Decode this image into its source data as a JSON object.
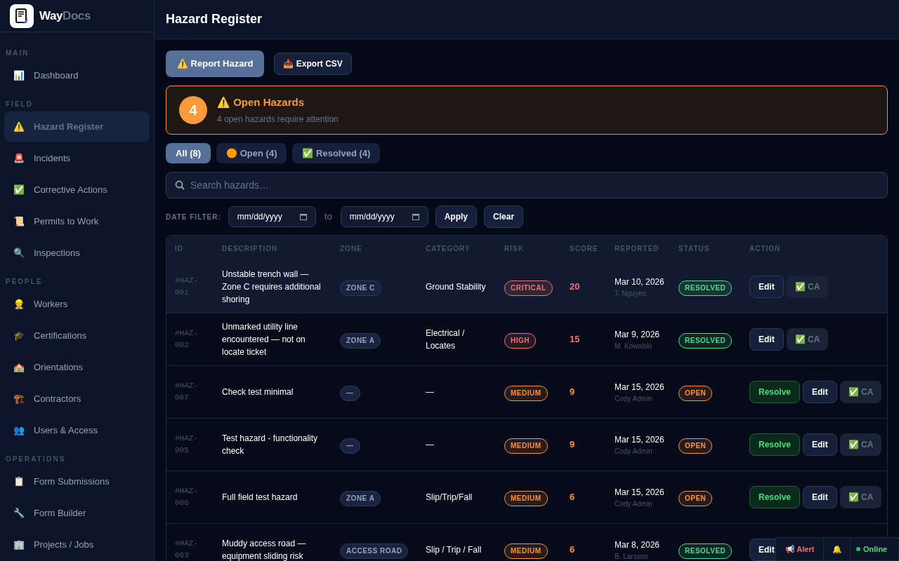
{
  "sidebar": {
    "logo": {
      "word_1": "Way",
      "word_2": "Docs"
    },
    "sections": [
      {
        "title": "MAIN",
        "items": [
          {
            "icon": "📊",
            "label": "Dashboard",
            "selected": false
          }
        ]
      },
      {
        "title": "FIELD",
        "items": [
          {
            "icon": "⚠️",
            "label": "Hazard Register",
            "selected": true
          },
          {
            "icon": "🚨",
            "label": "Incidents",
            "selected": false
          },
          {
            "icon": "✅",
            "label": "Corrective Actions",
            "selected": false
          },
          {
            "icon": "📜",
            "label": "Permits to Work",
            "selected": false
          },
          {
            "icon": "🔍",
            "label": "Inspections",
            "selected": false
          }
        ]
      },
      {
        "title": "PEOPLE",
        "items": [
          {
            "icon": "👷",
            "label": "Workers",
            "selected": false
          },
          {
            "icon": "🎓",
            "label": "Certifications",
            "selected": false
          },
          {
            "icon": "🏫",
            "label": "Orientations",
            "selected": false
          },
          {
            "icon": "🏗️",
            "label": "Contractors",
            "selected": false
          },
          {
            "icon": "👥",
            "label": "Users & Access",
            "selected": false
          }
        ]
      },
      {
        "title": "OPERATIONS",
        "items": [
          {
            "icon": "📋",
            "label": "Form Submissions",
            "selected": false
          },
          {
            "icon": "🔧",
            "label": "Form Builder",
            "selected": false
          },
          {
            "icon": "🏢",
            "label": "Projects / Jobs",
            "selected": false
          }
        ]
      }
    ]
  },
  "header": {
    "title": "Hazard Register"
  },
  "toolbar": {
    "buttons": [
      {
        "label": "⚠️ Report Hazard",
        "kind": "primary"
      },
      {
        "label": "📥 Export CSV",
        "kind": "secondary"
      }
    ]
  },
  "alert": {
    "count": "4",
    "title": "⚠️ Open Hazards",
    "message": "4 open hazards require attention"
  },
  "filter_tabs": [
    {
      "label": "All (8)",
      "selected": true
    },
    {
      "label": "🟠 Open (4)",
      "selected": false
    },
    {
      "label": "✅ Resolved (4)",
      "selected": false
    }
  ],
  "search": {
    "placeholder": "Search hazards…"
  },
  "date_filter": {
    "label": "DATE FILTER:",
    "from": "mm/dd/yyyy",
    "separator": "to",
    "to": "mm/dd/yyyy",
    "buttons": [
      "Apply",
      "Clear"
    ]
  },
  "table": {
    "columns": [
      "ID",
      "DESCRIPTION",
      "ZONE",
      "CATEGORY",
      "RISK",
      "SCORE",
      "REPORTED",
      "STATUS",
      "ACTION"
    ],
    "rows": [
      {
        "selected": true,
        "id": "#HAZ-001",
        "description": "Unstable trench wall — Zone C requires additional shoring",
        "zone": "ZONE C",
        "category": "Ground Stability",
        "risk": {
          "label": "CRITICAL",
          "color": "#f87171"
        },
        "score": "20",
        "date": "Mar 10, 2026",
        "reporter": "T. Nguyen",
        "status": {
          "label": "RESOLVED",
          "color": "#4ade80"
        },
        "actions": [
          {
            "label": "Edit",
            "kind": "edit"
          },
          {
            "label": "✅ CA",
            "kind": "ca"
          }
        ]
      },
      {
        "selected": false,
        "id": "#HAZ-002",
        "description": "Unmarked utility line encountered — not on locate ticket",
        "zone": "ZONE A",
        "category": "Electrical / Locates",
        "risk": {
          "label": "HIGH",
          "color": "#f87171"
        },
        "score": "15",
        "date": "Mar 9, 2026",
        "reporter": "M. Kowalski",
        "status": {
          "label": "RESOLVED",
          "color": "#4ade80"
        },
        "actions": [
          {
            "label": "Edit",
            "kind": "edit"
          },
          {
            "label": "✅ CA",
            "kind": "ca"
          }
        ]
      },
      {
        "selected": false,
        "id": "#HAZ-007",
        "description": "Check test minimal",
        "zone": "—",
        "category": "—",
        "risk": {
          "label": "MEDIUM",
          "color": "#fb923c"
        },
        "score": "9",
        "date": "Mar 15, 2026",
        "reporter": "Cody Admin",
        "status": {
          "label": "OPEN",
          "color": "#fb923c"
        },
        "actions": [
          {
            "label": "Resolve",
            "kind": "resolve"
          },
          {
            "label": "Edit",
            "kind": "edit"
          },
          {
            "label": "✅ CA",
            "kind": "ca"
          }
        ]
      },
      {
        "selected": false,
        "id": "#HAZ-005",
        "description": "Test hazard - functionality check",
        "zone": "—",
        "category": "—",
        "risk": {
          "label": "MEDIUM",
          "color": "#fb923c"
        },
        "score": "9",
        "date": "Mar 15, 2026",
        "reporter": "Cody Admin",
        "status": {
          "label": "OPEN",
          "color": "#fb923c"
        },
        "actions": [
          {
            "label": "Resolve",
            "kind": "resolve"
          },
          {
            "label": "Edit",
            "kind": "edit"
          },
          {
            "label": "✅ CA",
            "kind": "ca"
          }
        ]
      },
      {
        "selected": false,
        "id": "#HAZ-006",
        "description": "Full field test hazard",
        "zone": "ZONE A",
        "category": "Slip/Trip/Fall",
        "risk": {
          "label": "MEDIUM",
          "color": "#fb923c"
        },
        "score": "6",
        "date": "Mar 15, 2026",
        "reporter": "Cody Admin",
        "status": {
          "label": "OPEN",
          "color": "#fb923c"
        },
        "actions": [
          {
            "label": "Resolve",
            "kind": "resolve"
          },
          {
            "label": "Edit",
            "kind": "edit"
          },
          {
            "label": "✅ CA",
            "kind": "ca"
          }
        ]
      },
      {
        "selected": false,
        "id": "#HAZ-003",
        "description": "Muddy access road — equipment sliding risk",
        "zone": "ACCESS ROAD",
        "category": "Slip / Trip / Fall",
        "risk": {
          "label": "MEDIUM",
          "color": "#fb923c"
        },
        "score": "6",
        "date": "Mar 8, 2026",
        "reporter": "B. Larsson",
        "status": {
          "label": "RESOLVED",
          "color": "#4ade80"
        },
        "actions": [
          {
            "label": "Edit",
            "kind": "edit"
          }
        ]
      }
    ]
  },
  "status_bar": {
    "alert": "📢 Alert",
    "bell": "🔔",
    "online": {
      "label": "Online",
      "on": true
    }
  }
}
